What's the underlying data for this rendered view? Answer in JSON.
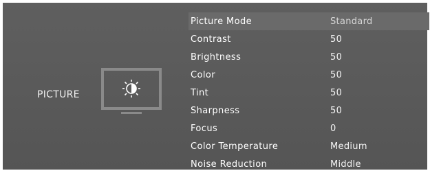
{
  "category": {
    "label": "PICTURE",
    "icon": "tv-brightness-icon"
  },
  "menu": {
    "items": [
      {
        "label": "Picture Mode",
        "value": "Standard"
      },
      {
        "label": "Contrast",
        "value": "50"
      },
      {
        "label": "Brightness",
        "value": "50"
      },
      {
        "label": "Color",
        "value": "50"
      },
      {
        "label": "Tint",
        "value": "50"
      },
      {
        "label": "Sharpness",
        "value": "50"
      },
      {
        "label": "Focus",
        "value": "0"
      },
      {
        "label": "Color Temperature",
        "value": "Medium"
      },
      {
        "label": "Noise Reduction",
        "value": "Middle"
      }
    ]
  },
  "colors": {
    "background": "#5b5b5b",
    "text": "#ffffff",
    "icon_frame": "#8a8a8a"
  }
}
